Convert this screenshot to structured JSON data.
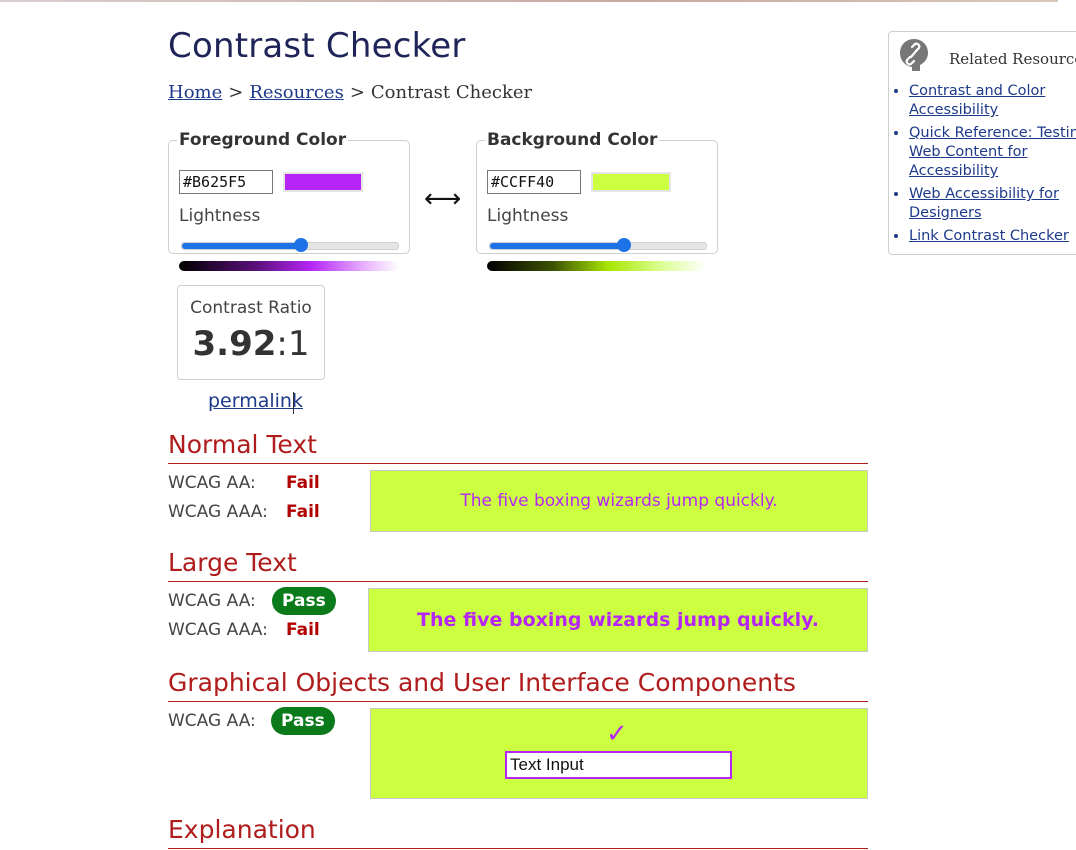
{
  "page": {
    "title": "Contrast Checker",
    "breadcrumb": {
      "home": "Home",
      "separator": ">",
      "resources": "Resources",
      "current": "Contrast Checker"
    }
  },
  "foreground": {
    "legend": "Foreground Color",
    "hex": "#B625F5",
    "lightness_label": "Lightness",
    "lightness_level": 0.55,
    "swatch_color": "#B625F5"
  },
  "background": {
    "legend": "Background Color",
    "hex": "#CCFF40",
    "lightness_label": "Lightness",
    "lightness_level": 0.62,
    "swatch_color": "#CCFF40"
  },
  "swap_icon": "left-right-arrow",
  "contrast": {
    "label": "Contrast Ratio",
    "value": "3.92",
    "suffix": ":1"
  },
  "permalink": "permalink",
  "normal_text": {
    "heading": "Normal Text",
    "aa_label": "WCAG AA:",
    "aa_result": "Fail",
    "aaa_label": "WCAG AAA:",
    "aaa_result": "Fail",
    "sample": "The five boxing wizards jump quickly."
  },
  "large_text": {
    "heading": "Large Text",
    "aa_label": "WCAG AA:",
    "aa_result": "Pass",
    "aaa_label": "WCAG AAA:",
    "aaa_result": "Fail",
    "sample": "The five boxing wizards jump quickly."
  },
  "graphical": {
    "heading": "Graphical Objects and User Interface Components",
    "aa_label": "WCAG AA:",
    "aa_result": "Pass",
    "check_icon": "checkmark",
    "input_value": "Text Input"
  },
  "explanation": {
    "heading": "Explanation"
  },
  "related": {
    "title": "Related Resources",
    "icon": "link-icon",
    "links": [
      "Contrast and Color Accessibility",
      "Quick Reference: Testing Web Content for Accessibility",
      "Web Accessibility for Designers",
      "Link Contrast Checker"
    ]
  },
  "colors": {
    "heading_red": "#B01C1C",
    "fail_red": "#B00000",
    "pass_green": "#0A7A1A",
    "link_blue": "#1E3A8A",
    "slider_blue": "#1E72E8",
    "title_navy": "#1F2458"
  }
}
